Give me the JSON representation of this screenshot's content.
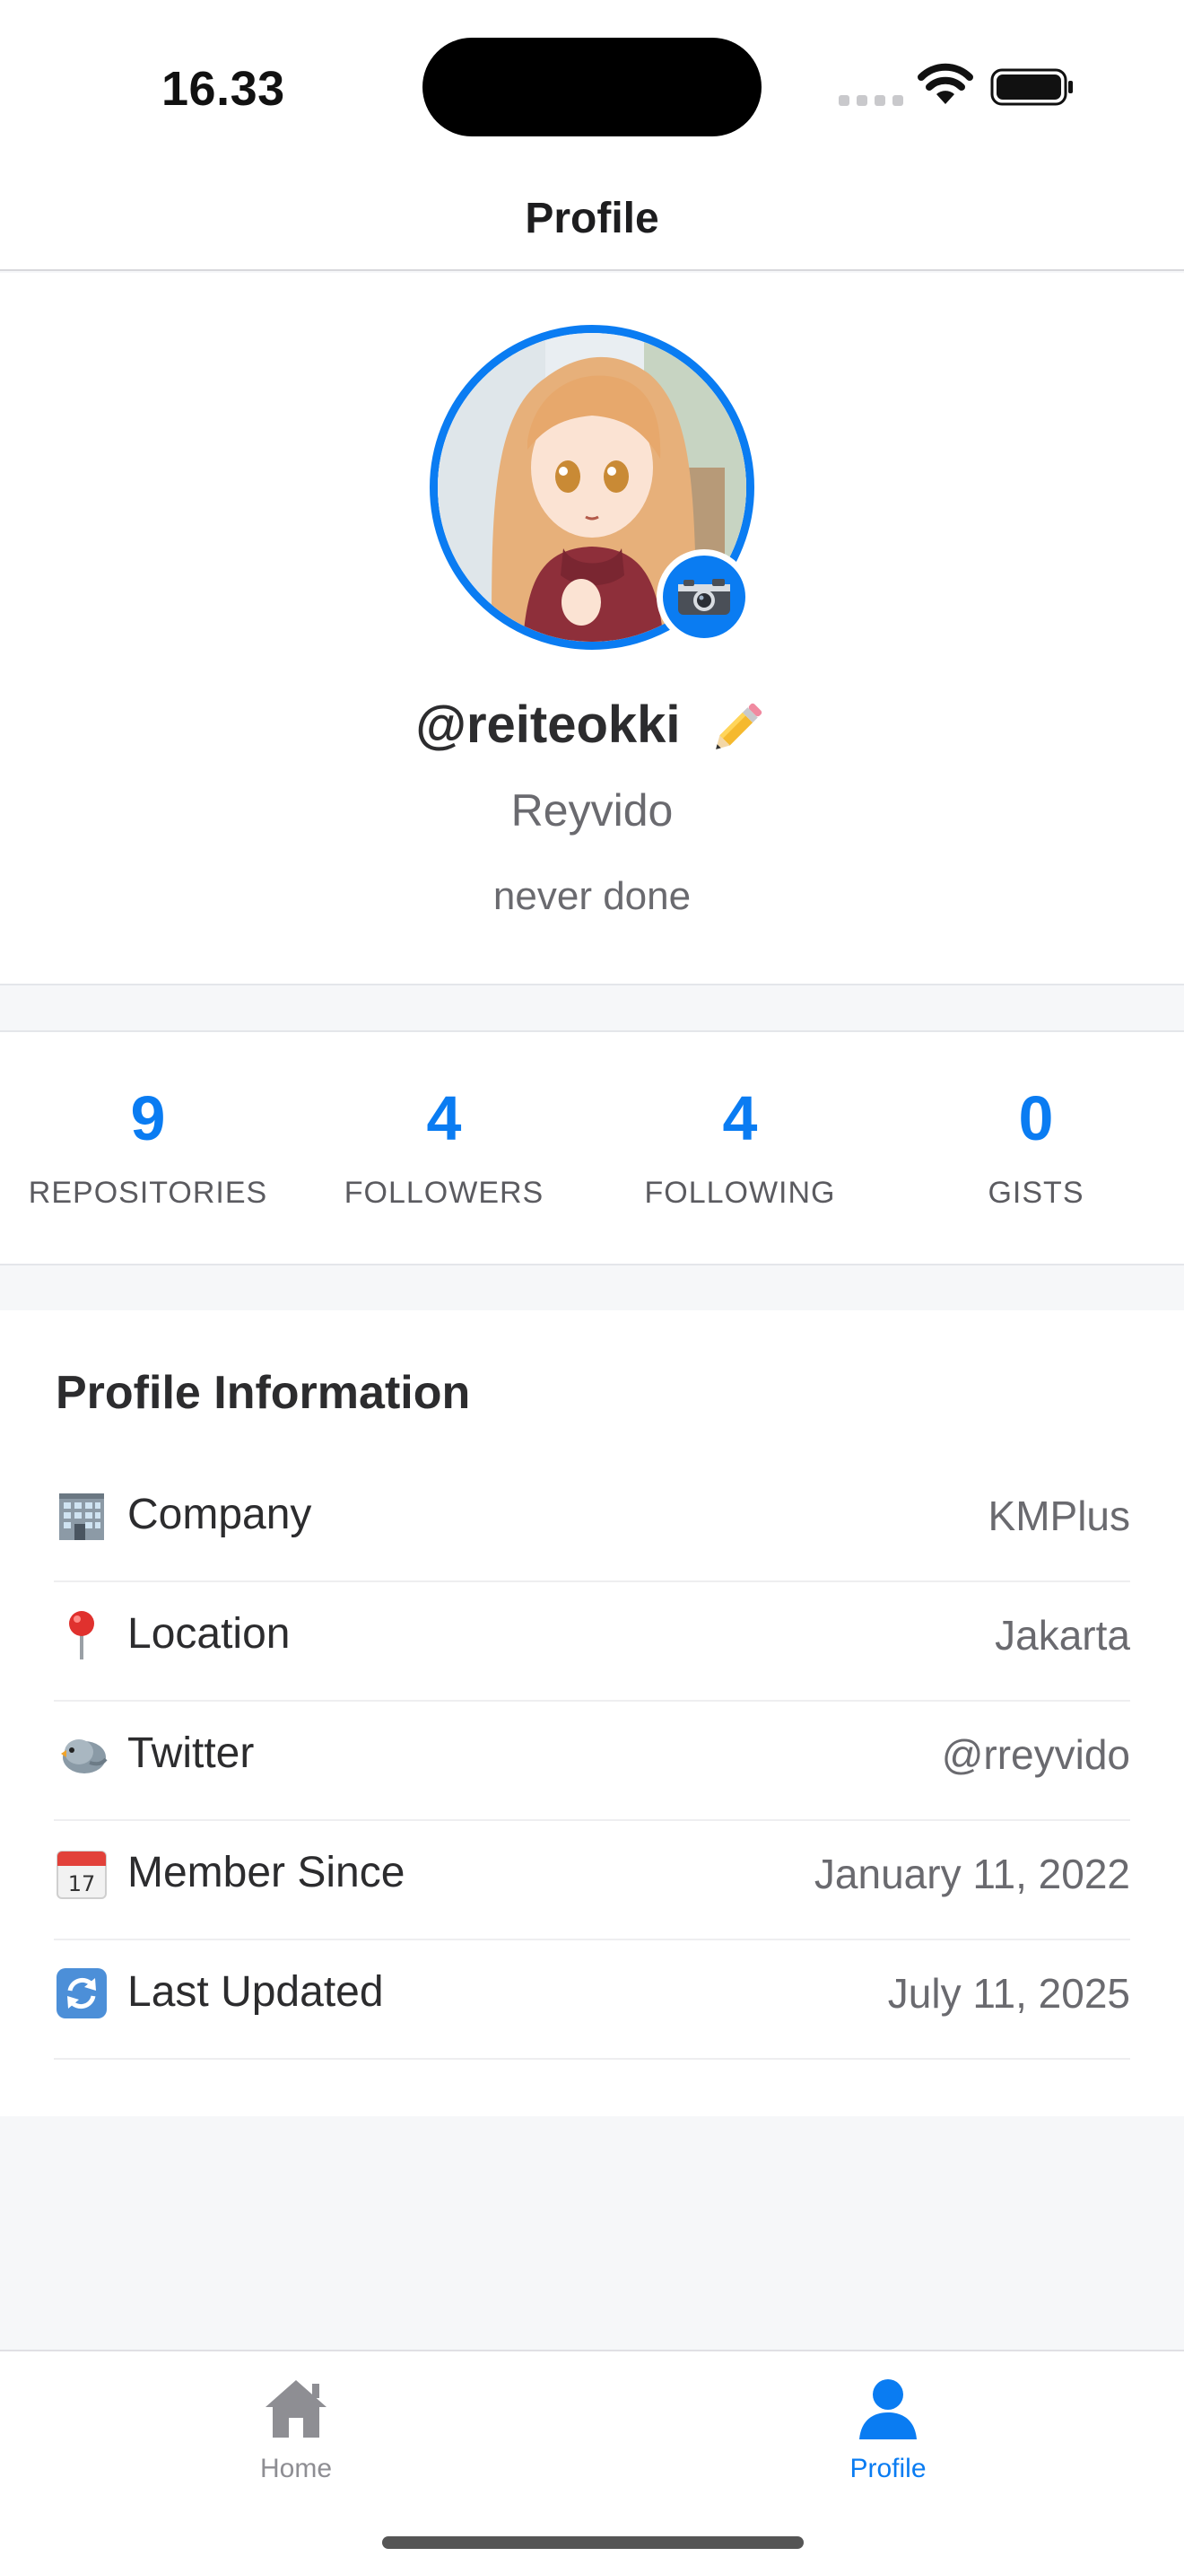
{
  "status_bar": {
    "time": "16.33"
  },
  "header": {
    "title": "Profile"
  },
  "profile": {
    "username": "@reiteokki",
    "display_name": "Reyvido",
    "bio": "never done",
    "edit_icon": "pencil-icon",
    "avatar_button_icon": "camera-icon"
  },
  "stats": [
    {
      "value": "9",
      "label": "REPOSITORIES"
    },
    {
      "value": "4",
      "label": "FOLLOWERS"
    },
    {
      "value": "4",
      "label": "FOLLOWING"
    },
    {
      "value": "0",
      "label": "GISTS"
    }
  ],
  "info": {
    "title": "Profile Information",
    "rows": [
      {
        "icon": "office-building-icon",
        "label": "Company",
        "value": "KMPlus"
      },
      {
        "icon": "map-pin-icon",
        "label": "Location",
        "value": "Jakarta"
      },
      {
        "icon": "bird-icon",
        "label": "Twitter",
        "value": "@rreyvido"
      },
      {
        "icon": "calendar-icon",
        "label": "Member Since",
        "value": "January 11, 2022"
      },
      {
        "icon": "refresh-icon",
        "label": "Last Updated",
        "value": "July 11, 2025"
      }
    ]
  },
  "tab_bar": {
    "tabs": [
      {
        "label": "Home",
        "icon": "house-icon",
        "active": false
      },
      {
        "label": "Profile",
        "icon": "person-icon",
        "active": true
      }
    ]
  },
  "colors": {
    "accent": "#0a7cf2",
    "inactive_tab": "#8e8e93",
    "background": "#f6f7f9"
  }
}
